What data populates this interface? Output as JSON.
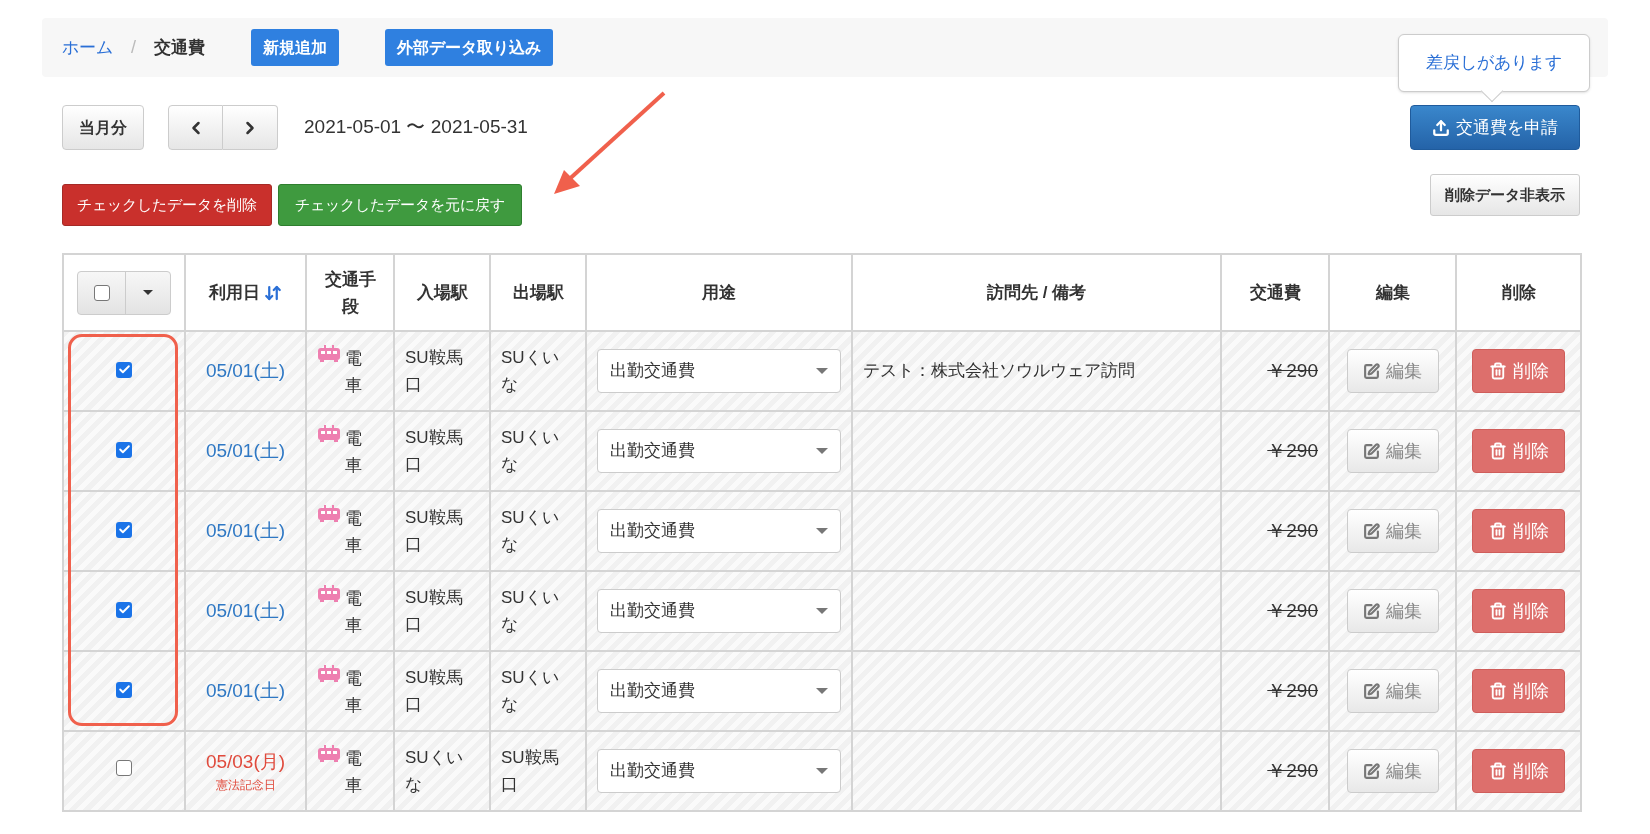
{
  "breadcrumb": {
    "home": "ホーム",
    "separator": "/",
    "current": "交通費"
  },
  "header_buttons": [
    "新規追加",
    "外部データ取り込み"
  ],
  "period": {
    "current_month_button": "当月分",
    "range": "2021-05-01 〜 2021-05-31"
  },
  "tooltip": "差戻しがあります",
  "submit_button": "交通費を申請",
  "bulk_buttons": {
    "delete": "チェックしたデータを削除",
    "restore": "チェックしたデータを元に戻す"
  },
  "hide_deleted_button": "削除データ非表示",
  "select_all": {
    "checked": false
  },
  "table": {
    "columns": [
      "利用日",
      "交通手段",
      "入場駅",
      "出場駅",
      "用途",
      "訪問先 / 備考",
      "交通費",
      "編集",
      "削除"
    ],
    "rows": [
      {
        "checked": true,
        "deleted": true,
        "holiday": false,
        "date": "05/01(土)",
        "transport": "電車",
        "entry": "SU鞍馬口",
        "exit": "SUくいな",
        "purpose": "出勤交通費",
        "note": "テスト：株式会社ソウルウェア訪問",
        "fare": "￥290",
        "edit": "編集",
        "delete": "削除"
      },
      {
        "checked": true,
        "deleted": true,
        "holiday": false,
        "date": "05/01(土)",
        "transport": "電車",
        "entry": "SU鞍馬口",
        "exit": "SUくいな",
        "purpose": "出勤交通費",
        "fare": "￥290",
        "edit": "編集",
        "delete": "削除"
      },
      {
        "checked": true,
        "deleted": true,
        "holiday": false,
        "date": "05/01(土)",
        "transport": "電車",
        "entry": "SU鞍馬口",
        "exit": "SUくいな",
        "purpose": "出勤交通費",
        "fare": "￥290",
        "edit": "編集",
        "delete": "削除"
      },
      {
        "checked": true,
        "deleted": true,
        "holiday": false,
        "date": "05/01(土)",
        "transport": "電車",
        "entry": "SU鞍馬口",
        "exit": "SUくいな",
        "purpose": "出勤交通費",
        "fare": "￥290",
        "edit": "編集",
        "delete": "削除"
      },
      {
        "checked": true,
        "deleted": true,
        "holiday": false,
        "date": "05/01(土)",
        "transport": "電車",
        "entry": "SU鞍馬口",
        "exit": "SUくいな",
        "purpose": "出勤交通費",
        "fare": "￥290",
        "edit": "編集",
        "delete": "削除"
      },
      {
        "checked": false,
        "deleted": true,
        "holiday": true,
        "date": "05/03(月)",
        "holiday_name": "憲法記念日",
        "transport": "電車",
        "entry": "SUくいな",
        "exit": "SU鞍馬口",
        "purpose": "出勤交通費",
        "fare": "￥290",
        "edit": "編集",
        "delete": "削除"
      }
    ]
  }
}
